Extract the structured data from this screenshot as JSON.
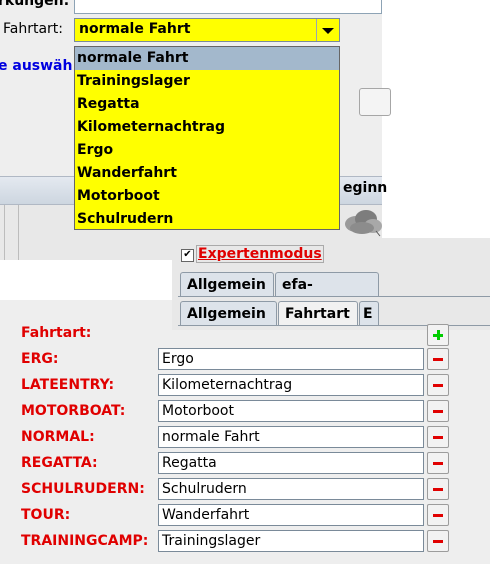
{
  "top": {
    "bemerkungen_label": "rkungen:",
    "fahrtart_label": "Fahrtart:",
    "auswaehlen_text": "e auswäh",
    "beginn_text": "eginn"
  },
  "combo": {
    "value": "normale Fahrt",
    "options": [
      "normale Fahrt",
      "Trainingslager",
      "Regatta",
      "Kilometernachtrag",
      "Ergo",
      "Wanderfahrt",
      "Motorboot",
      "Schulrudern"
    ],
    "selected_index": 0,
    "background": "#ffff00"
  },
  "expert": {
    "checkbox": "✔",
    "label": "Expertenmodus",
    "tabs_row1": [
      "Allgemein",
      "efa-Bootsha"
    ],
    "tabs_row2": [
      "Allgemein",
      "Fahrtart",
      "E"
    ]
  },
  "properties": {
    "header_label": "Fahrtart:",
    "rows": [
      {
        "key": "ERG:",
        "value": "Ergo"
      },
      {
        "key": "LATEENTRY:",
        "value": "Kilometernachtrag"
      },
      {
        "key": "MOTORBOAT:",
        "value": "Motorboot"
      },
      {
        "key": "NORMAL:",
        "value": "normale Fahrt"
      },
      {
        "key": "REGATTA:",
        "value": "Regatta"
      },
      {
        "key": "SCHULRUDERN:",
        "value": "Schulrudern"
      },
      {
        "key": "TOUR:",
        "value": "Wanderfahrt"
      },
      {
        "key": "TRAININGCAMP:",
        "value": "Trainingslager"
      }
    ]
  },
  "colors": {
    "label_red": "#e00000",
    "link_blue": "#0000e0",
    "add_green": "#00cc00",
    "selection": "#a3b8cc"
  },
  "icons": [
    "chevron-down-icon",
    "check-icon",
    "cloud-icon",
    "plus-icon",
    "minus-icon"
  ]
}
